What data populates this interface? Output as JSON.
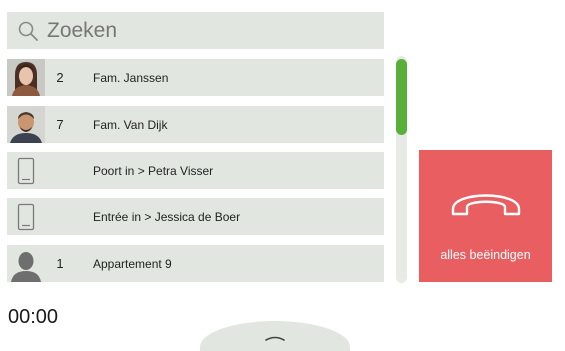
{
  "search": {
    "placeholder": "Zoeken"
  },
  "calls": [
    {
      "avatar": "woman-photo",
      "number": "2",
      "label": "Fam. Janssen"
    },
    {
      "avatar": "man-photo",
      "number": "7",
      "label": "Fam. Van Dijk"
    },
    {
      "avatar": "door-station-icon",
      "number": "",
      "label": "Poort in > Petra Visser"
    },
    {
      "avatar": "door-station-icon",
      "number": "",
      "label": "Entrée in > Jessica de Boer"
    },
    {
      "avatar": "person-silhouette-icon",
      "number": "1",
      "label": "Appartement 9"
    }
  ],
  "end_all": {
    "label": "alles beëindigen",
    "icon": "hang-up-icon",
    "color": "#e95f61"
  },
  "timer": "00:00",
  "colors": {
    "row_bg": "#e2e6e0",
    "scroll_thumb": "#58b03b",
    "end_button": "#e95f61"
  },
  "drawer": {
    "icon": "chevron-up-icon"
  }
}
